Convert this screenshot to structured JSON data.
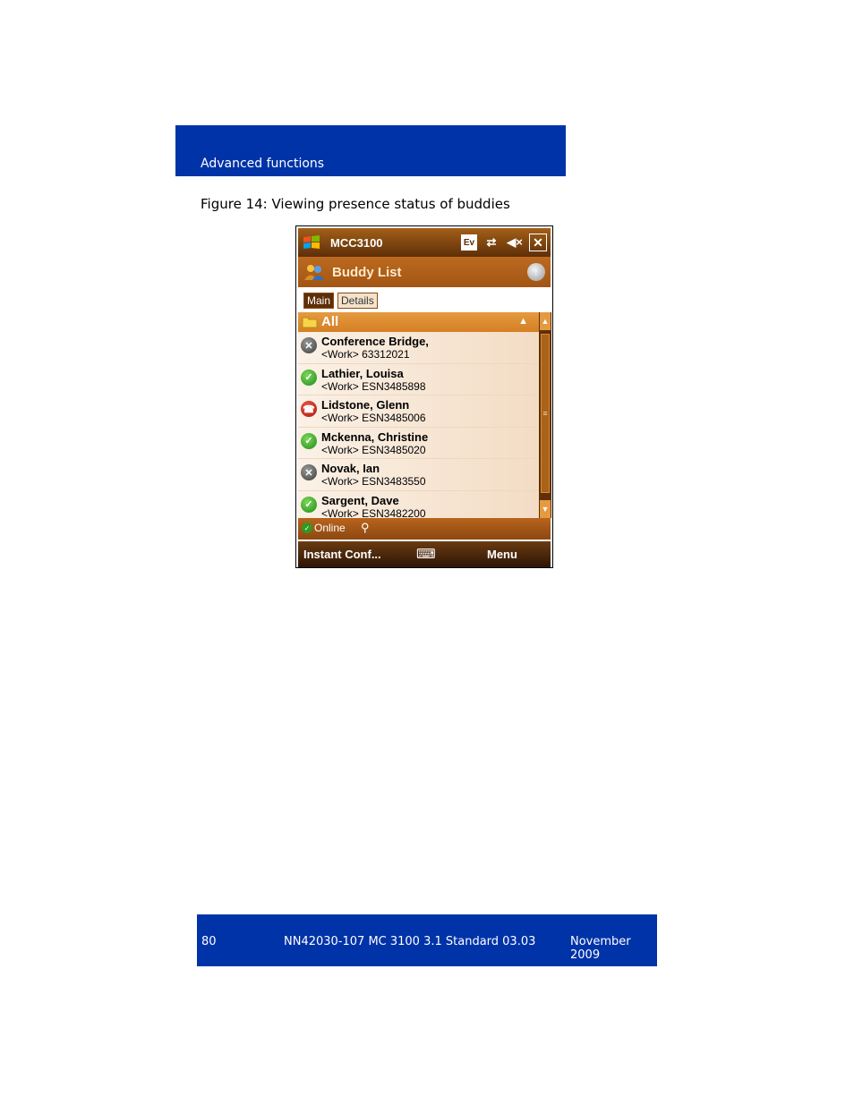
{
  "header": {
    "section": "Advanced functions"
  },
  "caption": "Figure 14: Viewing presence status of buddies",
  "device": {
    "app_name": "MCC3100",
    "title_icons": [
      "Ev",
      "connectivity-icon",
      "speaker-mute-icon",
      "close-icon"
    ],
    "screen_title": "Buddy List",
    "tabs": {
      "main": "Main",
      "details": "Details"
    },
    "group": "All",
    "buddies": [
      {
        "name": "Conference Bridge,",
        "number": "<Work> 63312021",
        "status": "offline"
      },
      {
        "name": "Lathier, Louisa",
        "number": "<Work> ESN3485898",
        "status": "online"
      },
      {
        "name": "Lidstone, Glenn",
        "number": "<Work> ESN3485006",
        "status": "busy"
      },
      {
        "name": "Mckenna, Christine",
        "number": "<Work> ESN3485020",
        "status": "online"
      },
      {
        "name": "Novak, Ian",
        "number": "<Work> ESN3483550",
        "status": "offline"
      },
      {
        "name": "Sargent, Dave",
        "number": "<Work> ESN3482200",
        "status": "online"
      }
    ],
    "status_button": "Online",
    "softkey_left": "Instant Conf...",
    "softkey_right": "Menu"
  },
  "footer": {
    "page": "80",
    "doc": "NN42030-107 MC 3100  3.1 Standard 03.03",
    "date": "November 2009"
  },
  "colors": {
    "brand_blue": "#0033a8",
    "title_brown": "#5e2f08",
    "accent_orange": "#d47f24"
  }
}
